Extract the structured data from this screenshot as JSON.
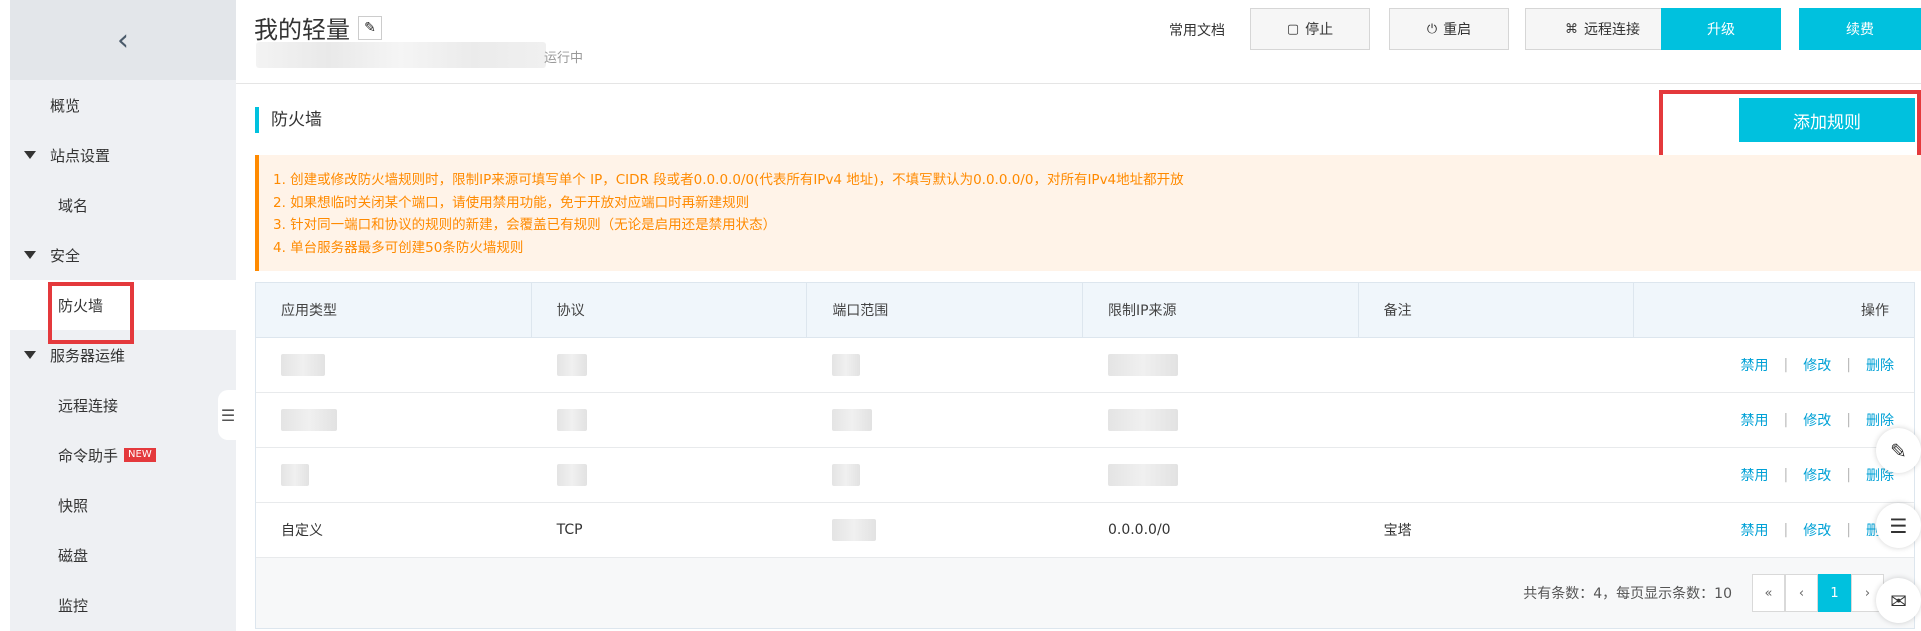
{
  "sidebar": {
    "back_icon": "chevron-left-icon",
    "items": [
      {
        "label": "概览"
      },
      {
        "label": "站点设置"
      },
      {
        "label": "域名"
      },
      {
        "label": "安全"
      },
      {
        "label": "防火墙"
      },
      {
        "label": "服务器运维"
      },
      {
        "label": "远程连接"
      },
      {
        "label": "命令助手"
      },
      {
        "label": "快照"
      },
      {
        "label": "磁盘"
      },
      {
        "label": "监控"
      }
    ],
    "new_badge": "NEW"
  },
  "header": {
    "title": "我的轻量",
    "status": "运行中",
    "doc_link": "常用文档",
    "stop_label": "停止",
    "restart_label": "重启",
    "remote_label": "远程连接",
    "upgrade_label": "升级",
    "renew_label": "续费"
  },
  "section": {
    "title": "防火墙",
    "add_rule_label": "添加规则"
  },
  "notice": [
    "1. 创建或修改防火墙规则时，限制IP来源可填写单个 IP，CIDR 段或者0.0.0.0/0(代表所有IPv4 地址)，不填写默认为0.0.0.0/0，对所有IPv4地址都开放",
    "2. 如果想临时关闭某个端口，请使用禁用功能，免于开放对应端口时再新建规则",
    "3. 针对同一端口和协议的规则的新建，会覆盖已有规则（无论是启用还是禁用状态）",
    "4. 单台服务器最多可创建50条防火墙规则"
  ],
  "table": {
    "headers": [
      "应用类型",
      "协议",
      "端口范围",
      "限制IP来源",
      "备注",
      "操作"
    ],
    "rows": [
      {
        "app_type": "",
        "protocol": "",
        "port": "",
        "ip": "",
        "note": ""
      },
      {
        "app_type": "",
        "protocol": "",
        "port": "",
        "ip": "",
        "note": ""
      },
      {
        "app_type": "",
        "protocol": "",
        "port": "",
        "ip": "",
        "note": ""
      },
      {
        "app_type": "自定义",
        "protocol": "TCP",
        "port": "",
        "ip": "0.0.0.0/0",
        "note": "宝塔"
      }
    ],
    "actions": {
      "disable": "禁用",
      "edit": "修改",
      "delete": "删除"
    }
  },
  "footer": {
    "summary": "共有条数：4，每页显示条数：10",
    "pager": {
      "first": "«",
      "prev": "‹",
      "current": "1",
      "next": "›"
    }
  },
  "colors": {
    "accent": "#00c1de",
    "warning": "#ff8a00",
    "highlight": "#e4393c"
  }
}
